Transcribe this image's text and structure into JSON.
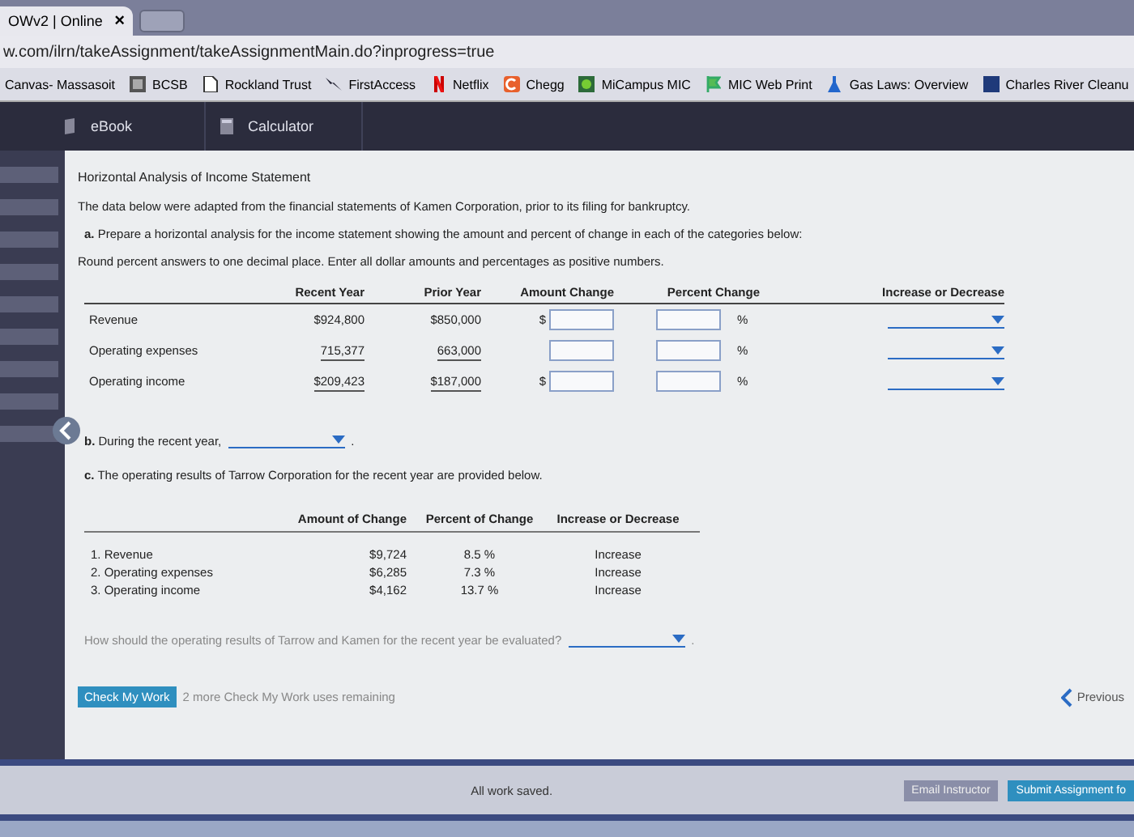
{
  "browser": {
    "tab_title": "OWv2 | Online",
    "tab_close": "×",
    "url": "w.com/ilrn/takeAssignment/takeAssignmentMain.do?inprogress=true",
    "bookmarks": [
      {
        "label": "Canvas- Massasoit"
      },
      {
        "label": "BCSB"
      },
      {
        "label": "Rockland Trust"
      },
      {
        "label": "FirstAccess"
      },
      {
        "label": "Netflix"
      },
      {
        "label": "Chegg"
      },
      {
        "label": "MiCampus MIC"
      },
      {
        "label": "MIC Web Print"
      },
      {
        "label": "Gas Laws: Overview"
      },
      {
        "label": "Charles River Cleanu"
      }
    ]
  },
  "nav": {
    "tabs": [
      {
        "label": "eBook"
      },
      {
        "label": "Calculator"
      }
    ]
  },
  "heading": "Horizontal Analysis of Income Statement",
  "intro": "The data below were adapted from the financial statements of Kamen Corporation, prior to its filing for bankruptcy.",
  "part_a": {
    "label": "a.",
    "text": "Prepare a horizontal analysis for the income statement showing the amount and percent of change in each of the categories below:",
    "instruction": "Round percent answers to one decimal place. Enter all dollar amounts and percentages as positive numbers.",
    "columns": [
      "Recent Year",
      "Prior Year",
      "Amount Change",
      "Percent Change",
      "Increase or Decrease"
    ],
    "rows": [
      {
        "label": "Revenue",
        "recent_year": "$924,800",
        "prior_year": "$850,000",
        "currency": "$",
        "percent_sign": "%",
        "underline": false
      },
      {
        "label": "Operating expenses",
        "recent_year": "715,377",
        "prior_year": "663,000",
        "percent_sign": "%",
        "underline": true
      },
      {
        "label": "Operating income",
        "recent_year": "$209,423",
        "prior_year": "$187,000",
        "currency": "$",
        "percent_sign": "%",
        "underline": true
      }
    ]
  },
  "part_b": {
    "label": "b.",
    "text": "During the recent year,",
    "suffix": "."
  },
  "part_c": {
    "label": "c.",
    "text": "The operating results of Tarrow Corporation for the recent year are provided below.",
    "columns": [
      "Amount of Change",
      "Percent of Change",
      "Increase or Decrease"
    ],
    "rows": [
      {
        "label": "1. Revenue",
        "amount": "$9,724",
        "percent": "8.5 %",
        "direction": "Increase"
      },
      {
        "label": "2. Operating expenses",
        "amount": "$6,285",
        "percent": "7.3 %",
        "direction": "Increase"
      },
      {
        "label": "3. Operating income",
        "amount": "$4,162",
        "percent": "13.7 %",
        "direction": "Increase"
      }
    ],
    "question": "How should the operating results of Tarrow and Kamen for the recent year be evaluated?",
    "suffix": "."
  },
  "footer": {
    "check_button": "Check My Work",
    "remaining": "2 more Check My Work uses remaining",
    "previous": "Previous"
  },
  "status_bar": {
    "status": "All work saved.",
    "email_button": "Email Instructor",
    "submit_button": "Submit Assignment fo"
  }
}
